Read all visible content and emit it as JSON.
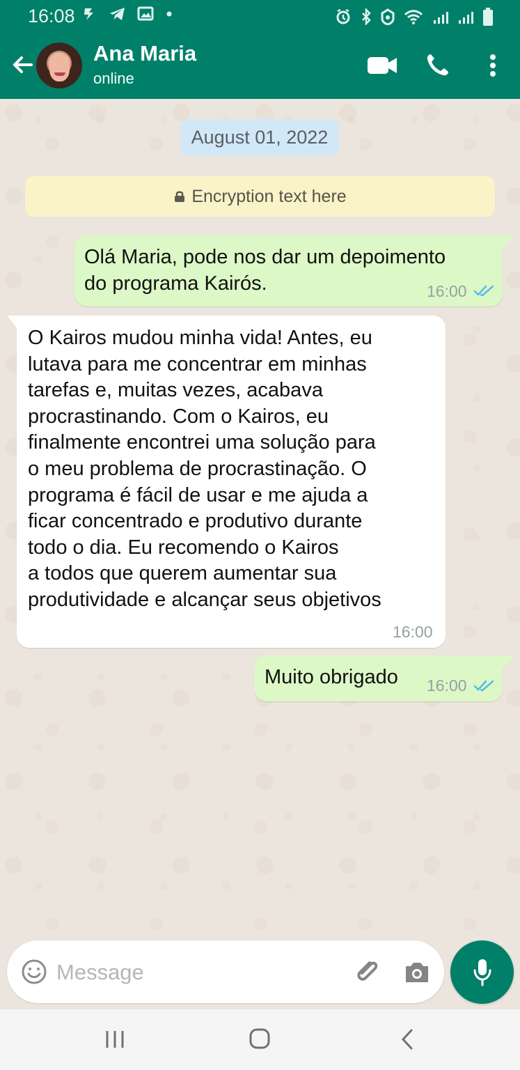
{
  "status_bar": {
    "time": "16:08",
    "left_icons": [
      "notification-icon",
      "telegram-icon",
      "image-icon",
      "dot-icon"
    ],
    "right_icons": [
      "alarm-icon",
      "bluetooth-icon",
      "security-icon",
      "wifi-icon",
      "signal-icon",
      "signal-icon",
      "battery-icon"
    ]
  },
  "header": {
    "contact_name": "Ana Maria",
    "status": "online",
    "icons": [
      "back-arrow-icon",
      "video-call-icon",
      "phone-icon",
      "more-options-icon"
    ]
  },
  "chat": {
    "date": "August 01, 2022",
    "encryption_notice": "Encryption text here",
    "messages": [
      {
        "direction": "sent",
        "text": "Olá Maria, pode nos dar um depoimento\ndo programa Kairós.",
        "time": "16:00",
        "read_receipt": "double-check-icon"
      },
      {
        "direction": "received",
        "text": "O Kairos mudou minha vida! Antes, eu\nlutava para me concentrar em minhas\ntarefas e, muitas vezes, acabava\nprocrastinando. Com o Kairos, eu\nfinalmente encontrei uma solução para\no meu problema de procrastinação. O\nprograma é fácil de usar e me ajuda a\nficar concentrado e produtivo durante\ntodo o dia. Eu recomendo o Kairos\na todos que querem aumentar sua\nprodutividade e alcançar seus objetivos",
        "time": "16:00"
      },
      {
        "direction": "sent",
        "text": "Muito obrigado",
        "time": "16:00",
        "read_receipt": "double-check-icon"
      }
    ]
  },
  "composer": {
    "placeholder": "Message",
    "icons": [
      "emoji-icon",
      "attachment-icon",
      "camera-icon",
      "microphone-icon"
    ]
  },
  "navigation": {
    "icons": [
      "recent-apps-icon",
      "home-icon",
      "back-icon"
    ]
  },
  "colors": {
    "brand": "#008069",
    "chat_background": "#ece5dd",
    "sent_bubble": "#dcf8c6",
    "received_bubble": "#ffffff",
    "read_ticks": "#53bdeb"
  }
}
